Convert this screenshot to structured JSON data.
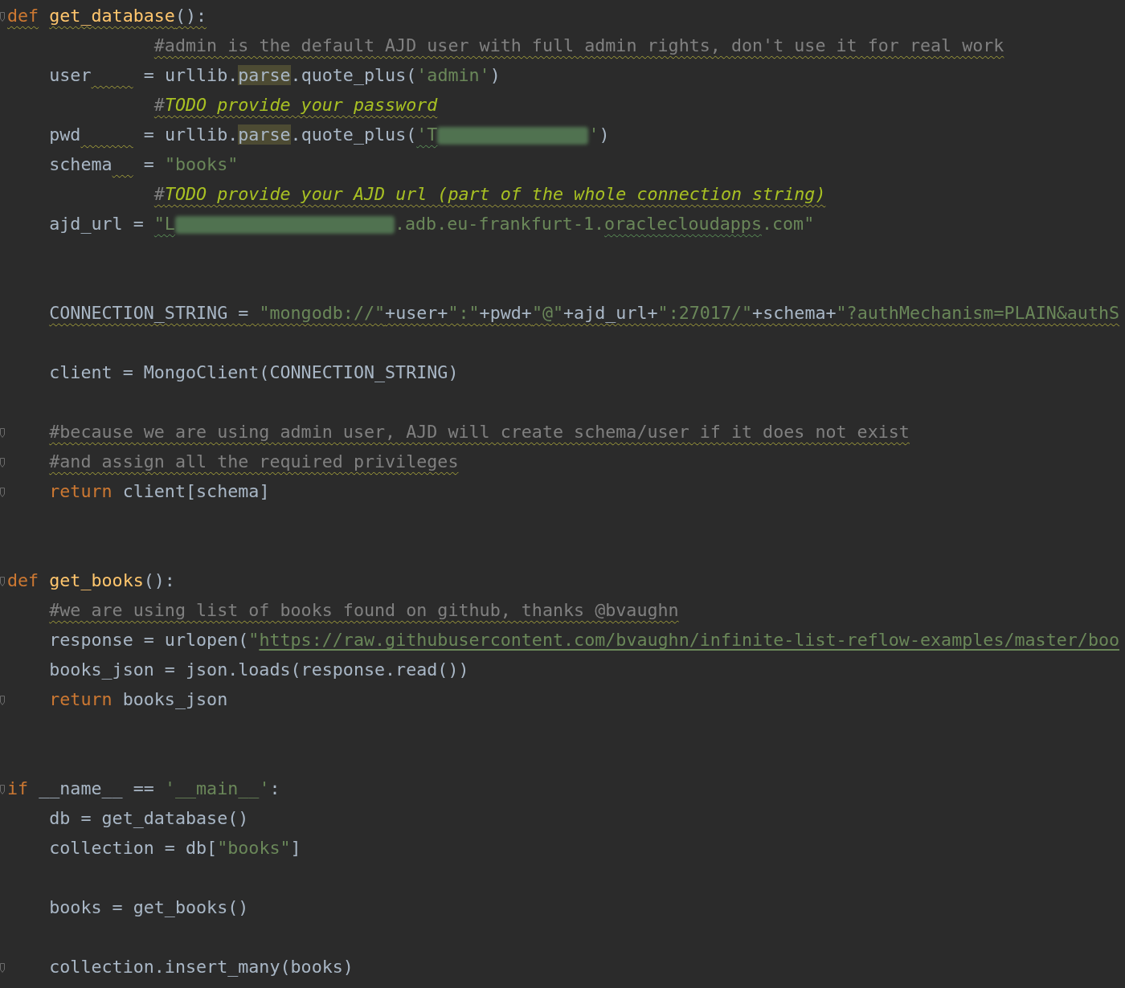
{
  "editor": {
    "lines": [
      {
        "kind": "code",
        "fold": true,
        "tokens": [
          {
            "text": "def",
            "kind": "keyword",
            "warning": true
          },
          {
            "text": " get_database",
            "kind": "function",
            "warning": true
          },
          {
            "text": "():",
            "kind": "plain",
            "warning": true
          }
        ]
      },
      {
        "kind": "code",
        "tokens": [
          {
            "text": "              #admin is the default AJD user with full admin rights, don't use it for real work",
            "kind": "comment",
            "warning": true
          }
        ]
      },
      {
        "kind": "code",
        "tokens": [
          {
            "text": "    user    ",
            "kind": "plain",
            "warning_gap": true
          },
          {
            "text": " = urllib.",
            "kind": "plain"
          },
          {
            "text": "parse",
            "kind": "highlight"
          },
          {
            "text": ".quote_plus(",
            "kind": "plain"
          },
          {
            "text": "'admin'",
            "kind": "string"
          },
          {
            "text": ")",
            "kind": "plain"
          }
        ]
      },
      {
        "kind": "code",
        "tokens": [
          {
            "text": "              #",
            "kind": "comment",
            "warning": true
          },
          {
            "text": "TODO provide your password",
            "kind": "todo",
            "warning": true
          }
        ]
      },
      {
        "kind": "code",
        "tokens": [
          {
            "text": "    pwd     ",
            "kind": "plain",
            "warning_gap": true
          },
          {
            "text": " = urllib.",
            "kind": "plain"
          },
          {
            "text": "parse",
            "kind": "highlight"
          },
          {
            "text": ".quote_plus(",
            "kind": "plain"
          },
          {
            "text": "'T",
            "kind": "string",
            "typo": true
          },
          {
            "kind": "redacted"
          },
          {
            "text": "'",
            "kind": "string"
          },
          {
            "text": ")",
            "kind": "plain"
          }
        ]
      },
      {
        "kind": "code",
        "tokens": [
          {
            "text": "    schema  ",
            "kind": "plain",
            "warning_gap": true
          },
          {
            "text": " = ",
            "kind": "plain"
          },
          {
            "text": "\"books\"",
            "kind": "string"
          }
        ]
      },
      {
        "kind": "code",
        "tokens": [
          {
            "text": "              #",
            "kind": "comment",
            "warning": true
          },
          {
            "text": "TODO provide your AJD url (part of the whole connection string)",
            "kind": "todo",
            "warning": true
          }
        ]
      },
      {
        "kind": "code",
        "tokens": [
          {
            "text": "    ajd_url = ",
            "kind": "plain"
          },
          {
            "text": "\"L",
            "kind": "string",
            "typo": true
          },
          {
            "kind": "redacted"
          },
          {
            "text": ".adb.eu-frankfurt-1.",
            "kind": "string"
          },
          {
            "text": "oraclecloudapps",
            "kind": "string",
            "typo": true
          },
          {
            "text": ".com\"",
            "kind": "string"
          }
        ]
      },
      {
        "kind": "blank"
      },
      {
        "kind": "blank"
      },
      {
        "kind": "code",
        "tokens": [
          {
            "text": "    CONNECTION_STRING = ",
            "kind": "plain",
            "warning": true
          },
          {
            "text": "\"mongodb://\"",
            "kind": "string",
            "warning": true
          },
          {
            "text": "+user+",
            "kind": "plain",
            "warning": true
          },
          {
            "text": "\":\"",
            "kind": "string",
            "warning": true
          },
          {
            "text": "+pwd+",
            "kind": "plain",
            "warning": true
          },
          {
            "text": "\"@\"",
            "kind": "string",
            "warning": true
          },
          {
            "text": "+ajd_url+",
            "kind": "plain",
            "warning": true
          },
          {
            "text": "\":27017/\"",
            "kind": "string",
            "warning": true
          },
          {
            "text": "+schema+",
            "kind": "plain",
            "warning": true
          },
          {
            "text": "\"?authMechanism=PLAIN&authS",
            "kind": "string",
            "warning": true
          }
        ]
      },
      {
        "kind": "blank"
      },
      {
        "kind": "code",
        "tokens": [
          {
            "text": "    client = MongoClient(CONNECTION_STRING)",
            "kind": "plain"
          }
        ]
      },
      {
        "kind": "blank"
      },
      {
        "kind": "code",
        "fold": true,
        "tokens": [
          {
            "text": "    #because we are using admin user, AJD will create schema/user if it does not exist",
            "kind": "comment",
            "warning": true
          }
        ]
      },
      {
        "kind": "code",
        "fold": true,
        "tokens": [
          {
            "text": "    #and assign all the required privileges",
            "kind": "comment",
            "warning": true
          }
        ]
      },
      {
        "kind": "code",
        "fold": true,
        "tokens": [
          {
            "text": "    return",
            "kind": "keyword"
          },
          {
            "text": " client[schema]",
            "kind": "plain"
          }
        ]
      },
      {
        "kind": "blank"
      },
      {
        "kind": "blank"
      },
      {
        "kind": "code",
        "fold": true,
        "tokens": [
          {
            "text": "def",
            "kind": "keyword"
          },
          {
            "text": " get_books",
            "kind": "function"
          },
          {
            "text": "():",
            "kind": "plain"
          }
        ]
      },
      {
        "kind": "code",
        "tokens": [
          {
            "text": "    #we are using list of books found on github, thanks @bvaughn",
            "kind": "comment",
            "warning": true
          }
        ]
      },
      {
        "kind": "code",
        "tokens": [
          {
            "text": "    response = urlopen(",
            "kind": "plain"
          },
          {
            "text": "\"",
            "kind": "string"
          },
          {
            "text": "https://raw.githubusercontent.com/bvaughn/infinite-list-reflow-examples/master/boo",
            "kind": "link"
          }
        ]
      },
      {
        "kind": "code",
        "tokens": [
          {
            "text": "    books_json = json.loads(response.read())",
            "kind": "plain"
          }
        ]
      },
      {
        "kind": "code",
        "fold": true,
        "tokens": [
          {
            "text": "    return",
            "kind": "keyword"
          },
          {
            "text": " books_json",
            "kind": "plain"
          }
        ]
      },
      {
        "kind": "blank"
      },
      {
        "kind": "blank"
      },
      {
        "kind": "code",
        "fold": true,
        "tokens": [
          {
            "text": "if",
            "kind": "keyword"
          },
          {
            "text": " __name__ == ",
            "kind": "plain"
          },
          {
            "text": "'__main__'",
            "kind": "string"
          },
          {
            "text": ":",
            "kind": "plain"
          }
        ]
      },
      {
        "kind": "code",
        "tokens": [
          {
            "text": "    db = get_database()",
            "kind": "plain"
          }
        ]
      },
      {
        "kind": "code",
        "tokens": [
          {
            "text": "    collection = db[",
            "kind": "plain"
          },
          {
            "text": "\"books\"",
            "kind": "string"
          },
          {
            "text": "]",
            "kind": "plain"
          }
        ]
      },
      {
        "kind": "blank"
      },
      {
        "kind": "code",
        "tokens": [
          {
            "text": "    books = get_books()",
            "kind": "plain"
          }
        ]
      },
      {
        "kind": "blank"
      },
      {
        "kind": "code",
        "fold": true,
        "tokens": [
          {
            "text": "    collection.insert_many(books)",
            "kind": "plain"
          }
        ]
      }
    ]
  }
}
